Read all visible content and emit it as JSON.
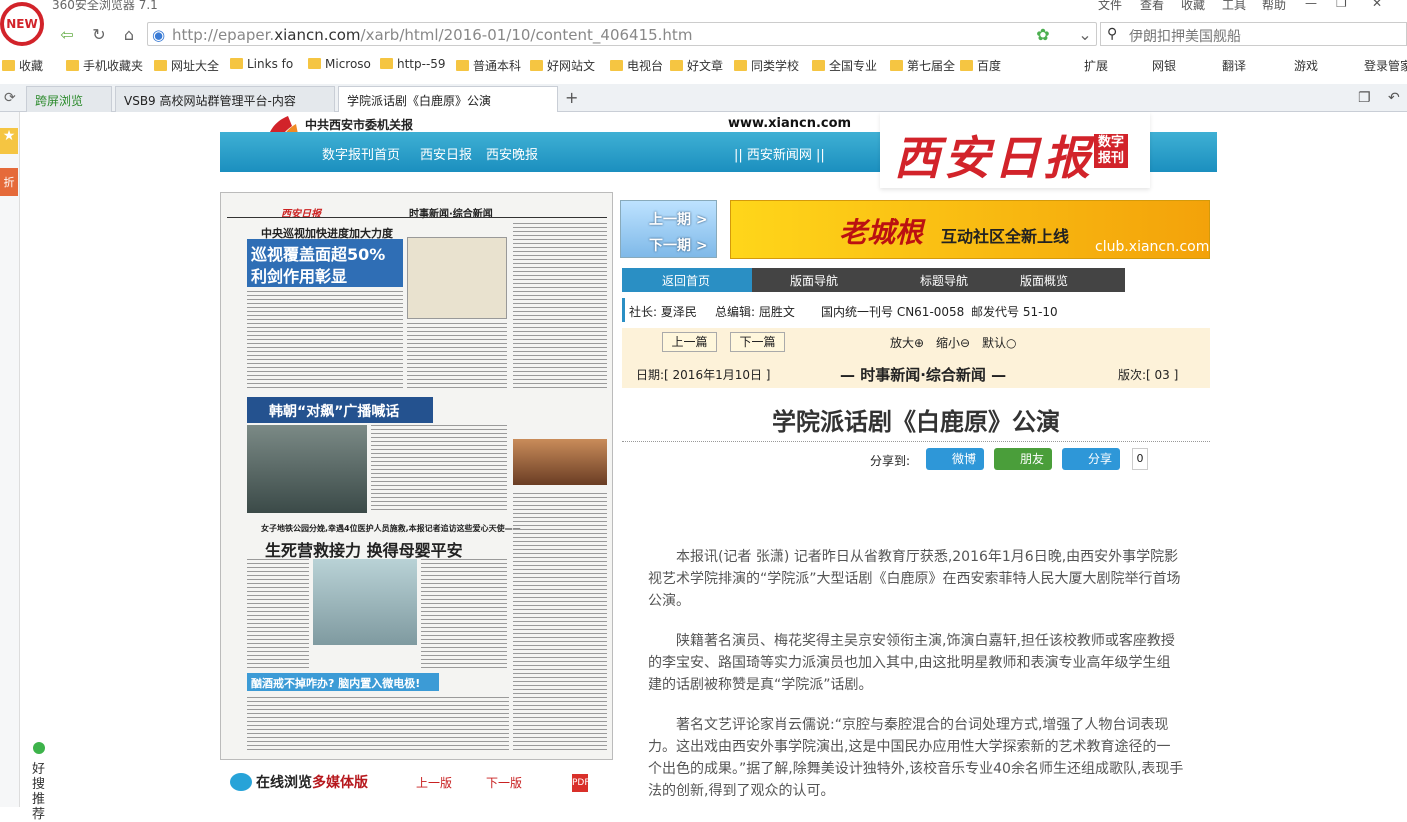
{
  "browser": {
    "app_title": "360安全浏览器 7.1",
    "menu": [
      "文件",
      "查看",
      "收藏",
      "工具",
      "帮助"
    ],
    "new_badge": "NEW",
    "url_prefix": "http://epaper.",
    "url_domain": "xiancn.com",
    "url_suffix": "/xarb/html/2016-01/10/content_406415.htm",
    "search_text": "伊朗扣押美国舰船",
    "bookmarks": [
      "收藏",
      "手机收藏夹",
      "网址大全",
      "Links fo",
      "Microso",
      "http--59",
      "普通本科",
      "好网站文",
      "电视台",
      "好文章",
      "同类学校",
      "全国专业",
      "第七届全",
      "百度"
    ],
    "bookmark_right": [
      "扩展",
      "网银",
      "翻译",
      "游戏",
      "登录管家"
    ],
    "tabs": [
      "跨屏浏览",
      "VSB9 高校网站群管理平台-内容",
      "学院派话剧《白鹿原》公演"
    ],
    "side_bottom": "好搜推荐"
  },
  "site": {
    "topline": "中共西安市委机关报",
    "domain": "www.xiancn.com",
    "links": [
      "数字报刊首页",
      "西安日报",
      "西安晚报"
    ],
    "net_link": "|| 西安新闻网 ||",
    "brand_name": "西安日报",
    "brand_tag": "数字报刊"
  },
  "paper": {
    "headlines": [
      "中央巡视加快进度加大力度",
      "巡视覆盖面超50%",
      "利剑作用彰显",
      "韩朝“对飙”广播喊话",
      "女子地铁公园分娩,幸遇4位医护人员施救,本报记者追访这些爱心天使——",
      "生死营救接力 换得母婴平安",
      "酗酒戒不掉咋办? 脑内置入微电极!",
      "西安日报",
      "时事新闻·综合新闻"
    ],
    "multimedia_label": "在线浏览",
    "multimedia_bold": "多媒体版",
    "prev_page": "上一版",
    "next_page": "下一版"
  },
  "nav": {
    "prev_issue": "上一期 >",
    "next_issue": "下一期 >"
  },
  "banner": {
    "title": "老城根",
    "subtitle": "互动社区全新上线",
    "url": "club.xiancn.com"
  },
  "tabs2": [
    "返回首页",
    "版面导航",
    "标题导航",
    "版面概览"
  ],
  "meta": {
    "president": "社长: 夏泽民",
    "editor": "总编辑: 屈胜文",
    "issn": "国内统一刊号 CN61-0058",
    "postal": "邮发代号 51-10"
  },
  "toolbar": {
    "prev_article": "上一篇",
    "next_article": "下一篇",
    "zoom_in": "放大⊕",
    "zoom_out": "缩小⊖",
    "default": "默认○"
  },
  "dateline": {
    "date": "日期:[ 2016年1月10日 ]",
    "section": "— 时事新闻·综合新闻 —",
    "page": "版次:[ 03 ]"
  },
  "article": {
    "title": "学院派话剧《白鹿原》公演",
    "share_label": "分享到:",
    "share_weibo": "微博",
    "share_friends": "朋友",
    "share_share": "分享",
    "share_count": "0",
    "paragraphs": [
      "本报讯(记者 张潇) 记者昨日从省教育厅获悉,2016年1月6日晚,由西安外事学院影视艺术学院排演的“学院派”大型话剧《白鹿原》在西安索菲特人民大厦大剧院举行首场公演。",
      "陕籍著名演员、梅花奖得主吴京安领衔主演,饰演白嘉轩,担任该校教师或客座教授的李宝安、路国琦等实力派演员也加入其中,由这批明星教师和表演专业高年级学生组建的话剧被称赞是真“学院派”话剧。",
      "著名文艺评论家肖云儒说:“京腔与秦腔混合的台词处理方式,增强了人物台词表现力。这出戏由西安外事学院演出,这是中国民办应用性大学探索新的艺术教育途径的一个出色的成果。”据了解,除舞美设计独特外,该校音乐专业40余名师生还组成歌队,表现手法的创新,得到了观众的认可。"
    ]
  },
  "colors": {
    "accent": "#2a8fc4",
    "brand_red": "#d2232a"
  }
}
